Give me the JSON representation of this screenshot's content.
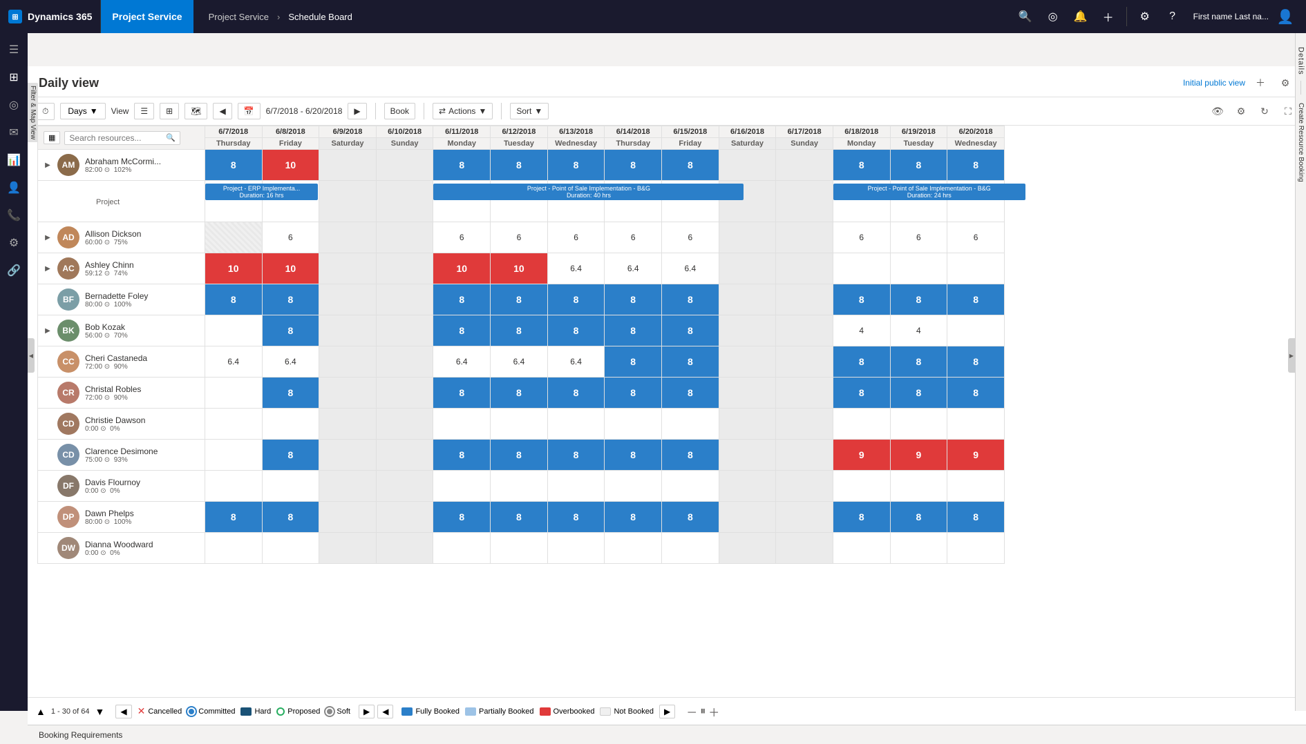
{
  "app": {
    "brand": "Dynamics 365",
    "module": "Project Service",
    "breadcrumb": [
      "Project Service",
      "Schedule Board"
    ],
    "user": "First name Last na...",
    "page_title": "Daily view",
    "initial_view_label": "Initial public view"
  },
  "toolbar": {
    "days_label": "Days",
    "view_label": "View",
    "date_range": "6/7/2018 - 6/20/2018",
    "book_label": "Book",
    "actions_label": "Actions",
    "sort_label": "Sort",
    "search_placeholder": "Search resources..."
  },
  "dates": [
    {
      "date": "6/7/2018",
      "day": "Thursday"
    },
    {
      "date": "6/8/2018",
      "day": "Friday"
    },
    {
      "date": "6/9/2018",
      "day": "Saturday"
    },
    {
      "date": "6/10/2018",
      "day": "Sunday"
    },
    {
      "date": "6/11/2018",
      "day": "Monday"
    },
    {
      "date": "6/12/2018",
      "day": "Tuesday"
    },
    {
      "date": "6/13/2018",
      "day": "Wednesday"
    },
    {
      "date": "6/14/2018",
      "day": "Thursday"
    },
    {
      "date": "6/15/2018",
      "day": "Friday"
    },
    {
      "date": "6/16/2018",
      "day": "Saturday"
    },
    {
      "date": "6/17/2018",
      "day": "Sunday"
    },
    {
      "date": "6/18/2018",
      "day": "Monday"
    },
    {
      "date": "6/19/2018",
      "day": "Tuesday"
    },
    {
      "date": "6/20/2018",
      "day": "Wednesday"
    }
  ],
  "resources": [
    {
      "name": "Abraham McCormi...",
      "hours": "82:00",
      "utilization": "102%",
      "expand": true,
      "sub_label": "Project",
      "avatar_initials": "AM",
      "avatar_color": "#8B6B4A",
      "values": [
        8,
        10,
        null,
        null,
        8,
        8,
        8,
        8,
        8,
        null,
        null,
        8,
        8,
        8
      ],
      "cell_types": [
        "blue",
        "red",
        "weekend",
        "weekend",
        "blue",
        "blue",
        "blue",
        "blue",
        "blue",
        "weekend",
        "weekend",
        "blue",
        "blue",
        "blue"
      ],
      "project_bar_1": {
        "start": 0,
        "span": 2,
        "label": "Project - ERP Implementa...",
        "duration": "Duration: 16 hrs"
      },
      "project_bar_2": {
        "start": 4,
        "span": 5,
        "label": "Project - Point of Sale Implementation - B&G",
        "duration": "Duration: 40 hrs"
      },
      "project_bar_3": {
        "start": 11,
        "span": 3,
        "label": "Project - Point of Sale Implementation - B&G",
        "duration": "Duration: 24 hrs"
      }
    },
    {
      "name": "Allison Dickson",
      "hours": "60:00",
      "utilization": "75%",
      "expand": true,
      "avatar_initials": "AD",
      "avatar_color": "#C0875A",
      "values": [
        null,
        6,
        null,
        null,
        6,
        6,
        6,
        6,
        6,
        null,
        null,
        6,
        6,
        6
      ],
      "cell_types": [
        "hatched",
        "gray",
        "weekend",
        "weekend",
        "gray",
        "gray",
        "gray",
        "gray",
        "gray",
        "weekend",
        "weekend",
        "gray",
        "gray",
        "gray"
      ]
    },
    {
      "name": "Ashley Chinn",
      "hours": "59:12",
      "utilization": "74%",
      "expand": true,
      "avatar_initials": "AC",
      "avatar_color": "#A0785A",
      "values": [
        10,
        10,
        null,
        null,
        10,
        10,
        6.4,
        6.4,
        6.4,
        null,
        null,
        null,
        null,
        null
      ],
      "cell_types": [
        "red",
        "red",
        "weekend",
        "weekend",
        "red",
        "red",
        "gray",
        "gray",
        "gray",
        "weekend",
        "weekend",
        "empty",
        "empty",
        "empty"
      ]
    },
    {
      "name": "Bernadette Foley",
      "hours": "80:00",
      "utilization": "100%",
      "expand": false,
      "avatar_initials": "BF",
      "avatar_color": "#7B9EA6",
      "values": [
        8,
        8,
        null,
        null,
        8,
        8,
        8,
        8,
        8,
        null,
        null,
        8,
        8,
        8
      ],
      "cell_types": [
        "blue",
        "blue",
        "weekend",
        "weekend",
        "blue",
        "blue",
        "blue",
        "blue",
        "blue",
        "weekend",
        "weekend",
        "blue",
        "blue",
        "blue"
      ]
    },
    {
      "name": "Bob Kozak",
      "hours": "56:00",
      "utilization": "70%",
      "expand": true,
      "avatar_initials": "BK",
      "avatar_color": "#6B8E6B",
      "values": [
        null,
        8,
        null,
        null,
        8,
        8,
        8,
        8,
        8,
        null,
        null,
        4,
        4,
        null
      ],
      "cell_types": [
        "empty",
        "blue",
        "weekend",
        "weekend",
        "blue",
        "blue",
        "blue",
        "blue",
        "blue",
        "weekend",
        "weekend",
        "gray",
        "gray",
        "empty"
      ]
    },
    {
      "name": "Cheri Castaneda",
      "hours": "72:00",
      "utilization": "90%",
      "expand": false,
      "avatar_initials": "CC",
      "avatar_color": "#C89068",
      "values": [
        6.4,
        6.4,
        null,
        null,
        6.4,
        6.4,
        6.4,
        8,
        8,
        null,
        null,
        8,
        8,
        8
      ],
      "cell_types": [
        "gray",
        "gray",
        "weekend",
        "weekend",
        "gray",
        "gray",
        "gray",
        "blue",
        "blue",
        "weekend",
        "weekend",
        "blue",
        "blue",
        "blue"
      ]
    },
    {
      "name": "Christal Robles",
      "hours": "72:00",
      "utilization": "90%",
      "expand": false,
      "avatar_initials": "CR",
      "avatar_color": "#B87A6A",
      "values": [
        null,
        8,
        null,
        null,
        8,
        8,
        8,
        8,
        8,
        null,
        null,
        8,
        8,
        8
      ],
      "cell_types": [
        "empty",
        "blue",
        "weekend",
        "weekend",
        "blue",
        "blue",
        "blue",
        "blue",
        "blue",
        "weekend",
        "weekend",
        "blue",
        "blue",
        "blue"
      ]
    },
    {
      "name": "Christie Dawson",
      "hours": "0:00",
      "utilization": "0%",
      "expand": false,
      "avatar_initials": "CD",
      "avatar_color": "#A07860",
      "values": [
        null,
        null,
        null,
        null,
        null,
        null,
        null,
        null,
        null,
        null,
        null,
        null,
        null,
        null
      ],
      "cell_types": [
        "empty",
        "empty",
        "weekend",
        "weekend",
        "empty",
        "empty",
        "empty",
        "empty",
        "empty",
        "weekend",
        "weekend",
        "empty",
        "empty",
        "empty"
      ]
    },
    {
      "name": "Clarence Desimone",
      "hours": "75:00",
      "utilization": "93%",
      "expand": false,
      "avatar_initials": "CD",
      "avatar_color": "#7890A8",
      "values": [
        null,
        8,
        null,
        null,
        8,
        8,
        8,
        8,
        8,
        null,
        null,
        9,
        9,
        9
      ],
      "cell_types": [
        "empty",
        "blue",
        "weekend",
        "weekend",
        "blue",
        "blue",
        "blue",
        "blue",
        "blue",
        "weekend",
        "weekend",
        "red",
        "red",
        "red"
      ]
    },
    {
      "name": "Davis Flournoy",
      "hours": "0:00",
      "utilization": "0%",
      "expand": false,
      "avatar_initials": "DF",
      "avatar_color": "#88786A",
      "values": [
        null,
        null,
        null,
        null,
        null,
        null,
        null,
        null,
        null,
        null,
        null,
        null,
        null,
        null
      ],
      "cell_types": [
        "empty",
        "empty",
        "weekend",
        "weekend",
        "empty",
        "empty",
        "empty",
        "empty",
        "empty",
        "weekend",
        "weekend",
        "empty",
        "empty",
        "empty"
      ]
    },
    {
      "name": "Dawn Phelps",
      "hours": "80:00",
      "utilization": "100%",
      "expand": false,
      "avatar_initials": "DP",
      "avatar_color": "#C0907A",
      "values": [
        8,
        8,
        null,
        null,
        8,
        8,
        8,
        8,
        8,
        null,
        null,
        8,
        8,
        8
      ],
      "cell_types": [
        "blue",
        "blue",
        "weekend",
        "weekend",
        "blue",
        "blue",
        "blue",
        "blue",
        "blue",
        "weekend",
        "weekend",
        "blue",
        "blue",
        "blue"
      ]
    },
    {
      "name": "Dianna Woodward",
      "hours": "0:00",
      "utilization": "0%",
      "expand": false,
      "avatar_initials": "DW",
      "avatar_color": "#A08878",
      "values": [
        null,
        null,
        null,
        null,
        null,
        null,
        null,
        null,
        null,
        null,
        null,
        null,
        null,
        null
      ],
      "cell_types": [
        "empty",
        "empty",
        "weekend",
        "weekend",
        "empty",
        "empty",
        "empty",
        "empty",
        "empty",
        "weekend",
        "weekend",
        "empty",
        "empty",
        "empty"
      ]
    }
  ],
  "pagination": {
    "current": "1 - 30 of 64",
    "prev": "‹",
    "next": "›"
  },
  "legend": {
    "cancelled_label": "Cancelled",
    "committed_label": "Committed",
    "hard_label": "Hard",
    "proposed_label": "Proposed",
    "soft_label": "Soft",
    "fully_booked_label": "Fully Booked",
    "partially_booked_label": "Partially Booked",
    "overbooked_label": "Overbooked",
    "not_booked_label": "Not Booked"
  },
  "booking_requirements": "Booking Requirements",
  "sidebar_icons": [
    "≡",
    "☰",
    "◉",
    "✉",
    "☁",
    "👤",
    "📞",
    "⚙",
    "🔗"
  ],
  "details_label": "Details",
  "create_resource_label": "Create Resource Booking"
}
